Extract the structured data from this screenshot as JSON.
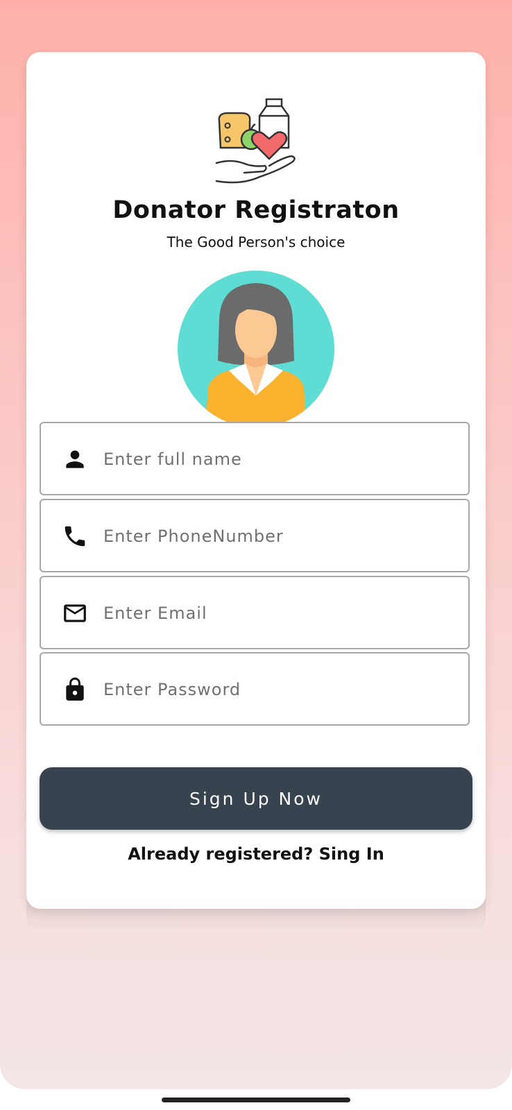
{
  "header": {
    "title": "Donator Registraton",
    "subtitle": "The Good Person's choice"
  },
  "logo_icon": "food-donation-hand-icon",
  "avatar_icon": "woman-avatar-icon",
  "form": {
    "fields": [
      {
        "icon": "person-icon",
        "placeholder": "Enter full name",
        "value": ""
      },
      {
        "icon": "phone-icon",
        "placeholder": "Enter PhoneNumber",
        "value": ""
      },
      {
        "icon": "mail-icon",
        "placeholder": "Enter Email",
        "value": ""
      },
      {
        "icon": "lock-icon",
        "placeholder": "Enter Password",
        "value": ""
      }
    ],
    "submit_label": "Sign Up Now",
    "signin_label": "Already registered? Sing In"
  },
  "colors": {
    "button": "#37444f",
    "background_top": "#ffb0aa",
    "avatar_circle": "#5fdcd4",
    "avatar_shirt": "#fbb32f"
  }
}
